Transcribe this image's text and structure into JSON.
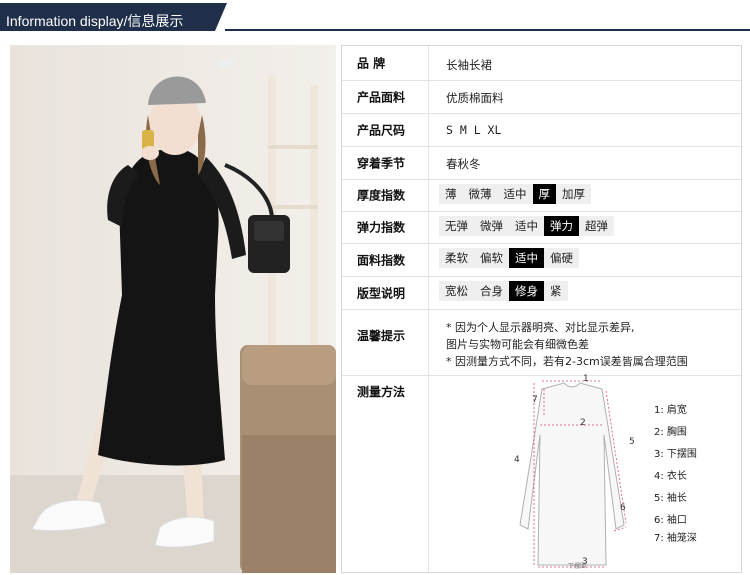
{
  "header": {
    "title": "Information display/信息展示"
  },
  "photo": {
    "badge": "♥"
  },
  "rows": [
    {
      "label": "品    牌",
      "value": "长袖长裙"
    },
    {
      "label": "产品面料",
      "value": "优质棉面料"
    },
    {
      "label": "产品尺码",
      "value": "S  M  L  XL"
    },
    {
      "label": "穿着季节",
      "value": "春秋冬"
    }
  ],
  "scales": [
    {
      "label": "厚度指数",
      "options": [
        "薄",
        "微薄",
        "适中",
        "厚",
        "加厚"
      ],
      "selected": "厚"
    },
    {
      "label": "弹力指数",
      "options": [
        "无弹",
        "微弹",
        "适中",
        "弹力",
        "超弹"
      ],
      "selected": "弹力"
    },
    {
      "label": "面料指数",
      "options": [
        "柔软",
        "偏软",
        "适中",
        "偏硬"
      ],
      "selected": "适中"
    },
    {
      "label": "版型说明",
      "options": [
        "宽松",
        "合身",
        "修身",
        "紧"
      ],
      "selected": "修身"
    }
  ],
  "notice": {
    "label": "温馨提示",
    "lines": [
      "* 因为个人显示器明亮、对比显示差异,",
      "图片与实物可能会有细微色差",
      "* 因测量方式不同，若有2-3cm误差皆属合理范围"
    ]
  },
  "measure": {
    "label": "测量方法",
    "points": [
      "1",
      "2",
      "3",
      "4",
      "5",
      "6",
      "7"
    ],
    "legend": [
      "1: 肩宽",
      "2: 胸围",
      "3: 下摆围",
      "4: 衣长",
      "5: 袖长",
      "6: 袖口",
      "7: 袖笼深"
    ],
    "bottom_caption": "下摆围"
  },
  "colors": {
    "header_bg": "#1f2f4a",
    "selected_bg": "#000000",
    "option_bg": "#efefef",
    "marker": "#e0457b"
  }
}
